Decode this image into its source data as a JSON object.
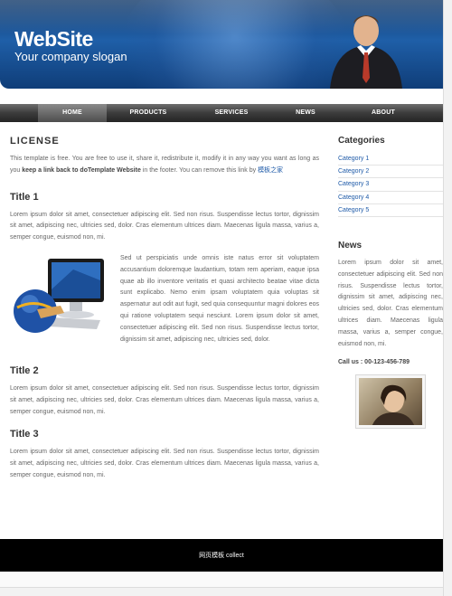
{
  "header": {
    "logo": "WebSite",
    "slogan": "Your company slogan"
  },
  "nav": {
    "items": [
      {
        "label": "HOME",
        "active": true
      },
      {
        "label": "PRODUCTS",
        "active": false
      },
      {
        "label": "SERVICES",
        "active": false
      },
      {
        "label": "NEWS",
        "active": false
      },
      {
        "label": "ABOUT",
        "active": false
      }
    ]
  },
  "main": {
    "license_title": "LICENSE",
    "license_text_a": "This template is free. You are free to use it, share it, redistribute it, modify it in any way you want as long as you ",
    "license_text_bold": "keep a link back to doTemplate Website",
    "license_text_b": " in the footer. You can remove this link by ",
    "license_link": "模板之家",
    "title1": "Title 1",
    "para1": "Lorem ipsum dolor sit amet, consectetuer adipiscing elit. Sed non risus. Suspendisse lectus tortor, dignissim sit amet, adipiscing nec, ultricies sed, dolor. Cras elementum ultrices diam. Maecenas ligula massa, varius a, semper congue, euismod non, mi.",
    "para_image": "Sed ut perspiciatis unde omnis iste natus error sit voluptatem accusantium doloremque laudantium, totam rem aperiam, eaque ipsa quae ab illo inventore veritatis et quasi architecto beatae vitae dicta sunt explicabo. Nemo enim ipsam voluptatem quia voluptas sit aspernatur aut odit aut fugit, sed quia consequuntur magni dolores eos qui ratione voluptatem sequi nesciunt. Lorem ipsum dolor sit amet, consectetuer adipiscing elit. Sed non risus. Suspendisse lectus tortor, dignissim sit amet, adipiscing nec, ultricies sed, dolor.",
    "title2": "Title 2",
    "para2": "Lorem ipsum dolor sit amet, consectetuer adipiscing elit. Sed non risus. Suspendisse lectus tortor, dignissim sit amet, adipiscing nec, ultricies sed, dolor. Cras elementum ultrices diam. Maecenas ligula massa, varius a, semper congue, euismod non, mi.",
    "title3": "Title 3",
    "para3": "Lorem ipsum dolor sit amet, consectetuer adipiscing elit. Sed non risus. Suspendisse lectus tortor, dignissim sit amet, adipiscing nec, ultricies sed, dolor. Cras elementum ultrices diam. Maecenas ligula massa, varius a, semper congue, euismod non, mi."
  },
  "sidebar": {
    "categories_title": "Categories",
    "categories": [
      "Category 1",
      "Category 2",
      "Category 3",
      "Category 4",
      "Category 5"
    ],
    "news_title": "News",
    "news_text": "Lorem ipsum dolor sit amet, consectetuer adipiscing elit. Sed non risus. Suspendisse lectus tortor, dignissim sit amet, adipiscing nec, ultricies sed, dolor. Cras elementum ultrices diam. Maecenas ligula massa, varius a, semper congue, euismod non, mi.",
    "call": "Call us : 00-123-456-789"
  },
  "footer": {
    "text": "网页模板 collect"
  },
  "colors": {
    "header_blue": "#1f5fa8",
    "link_blue": "#1e5aa8",
    "nav_dark": "#3c3c3c",
    "footer_black": "#000000"
  },
  "icons": [
    "monitor-globe-illustration",
    "businessman-photo",
    "woman-photo"
  ]
}
